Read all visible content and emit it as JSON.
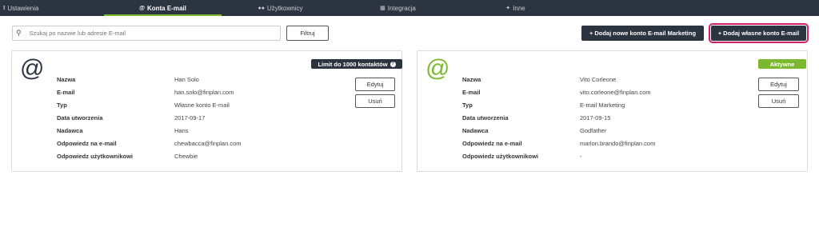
{
  "tabs": [
    {
      "label": "Ustawienia",
      "icon": "exclamation-icon"
    },
    {
      "label": "Konta E-mail",
      "icon": "at-icon"
    },
    {
      "label": "Użytkownicy",
      "icon": "users-icon"
    },
    {
      "label": "Integracja",
      "icon": "integration-icon"
    },
    {
      "label": "Inne",
      "icon": "wrench-icon"
    }
  ],
  "toolbar": {
    "search_placeholder": "Szukaj po nazwie lub adresie E-mail",
    "filter_label": "Filtruj",
    "add_marketing_label": "Dodaj nowe konto E-mail Marketing",
    "add_own_label": "Dodaj własne konto E-mail"
  },
  "colors": {
    "topbar": "#2c3440",
    "accent": "#7cb82f",
    "highlight": "#d41e6a"
  },
  "labels": [
    "Nazwa",
    "E-mail",
    "Typ",
    "Data utworzenia",
    "Nadawca",
    "Odpowiedz na e-mail",
    "Odpowiedz użytkownikowi"
  ],
  "accounts": [
    {
      "badge": "Limit do 1000 kontaktów",
      "values": [
        "Han Solo",
        "han.solo@finplan.com",
        "Własne konto E-mail",
        "2017-09-17",
        "Hans",
        "chewbacca@finplan.com",
        "Chewbie"
      ],
      "edit_label": "Edytuj",
      "delete_label": "Usuń"
    },
    {
      "badge": "Aktywne",
      "values": [
        "Vito Corleone",
        "vito.corleone@finplan.com",
        "E-mail Marketing",
        "2017-09-15",
        "Godfather",
        "marlon.brando@finplan.com",
        "-"
      ],
      "edit_label": "Edytuj",
      "delete_label": "Usuń"
    }
  ]
}
